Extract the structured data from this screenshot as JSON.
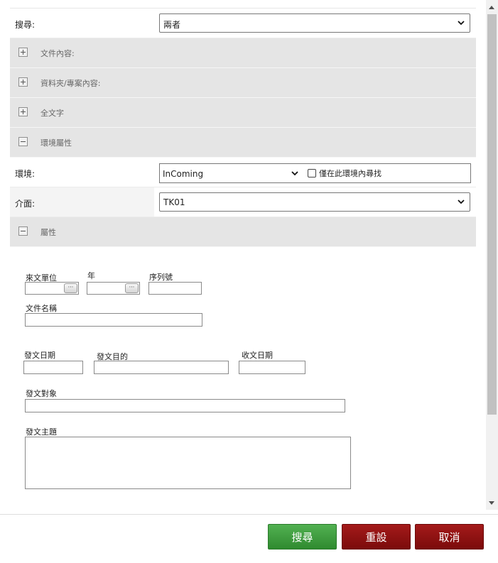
{
  "search_row": {
    "label": "搜尋:",
    "value": "兩者"
  },
  "sections": {
    "doc_content": "文件內容:",
    "folder_content": "資料夾/專案內容:",
    "full_text": "全文字",
    "env_props": "環境屬性",
    "props": "屬性"
  },
  "environment": {
    "label": "環境:",
    "value": "InComing",
    "only_this_label": "僅在此環境內尋找",
    "only_this_checked": false
  },
  "interface": {
    "label": "介面:",
    "value": "TK01"
  },
  "fields": {
    "sender_unit": "來文單位",
    "year": "年",
    "serial_no": "序列號",
    "doc_name": "文件名稱",
    "send_date": "發文日期",
    "send_purpose": "發文目的",
    "receive_date": "收文日期",
    "send_target": "發文對象",
    "send_subject": "發文主題",
    "picker_glyph": "···"
  },
  "buttons": {
    "search": "搜尋",
    "reset": "重設",
    "cancel": "取消"
  },
  "colors": {
    "search_btn": "#3c9b3c",
    "reset_btn": "#8e1010",
    "cancel_btn": "#8e1010",
    "section_bg": "#e5e5e5"
  }
}
